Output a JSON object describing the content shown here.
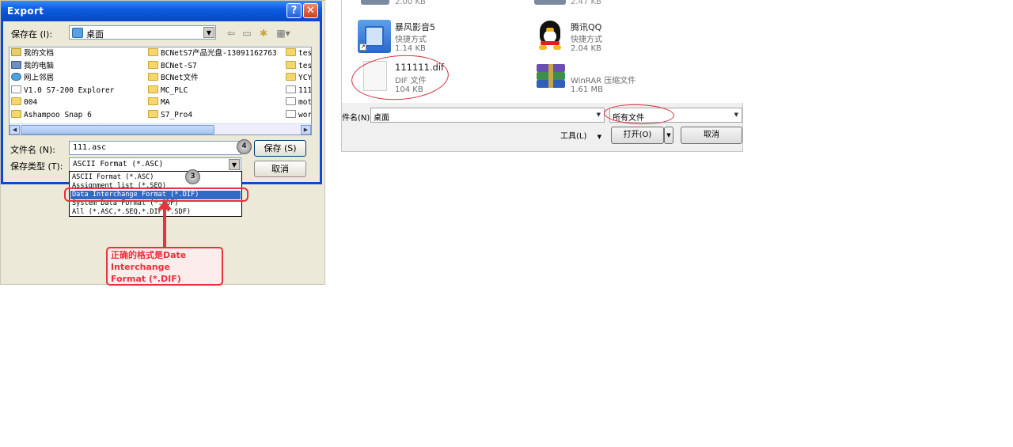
{
  "export_dialog": {
    "title": "Export",
    "help_glyph": "?",
    "close_glyph": "✕",
    "save_in_label": "保存在 (I):",
    "save_in_value": "桌面",
    "toolbar_icons": [
      "back-arrow-icon",
      "up-folder-icon",
      "new-folder-icon",
      "view-menu-icon"
    ],
    "files": [
      {
        "icon": "my-documents-icon",
        "name": "我的文档"
      },
      {
        "icon": "my-computer-icon",
        "name": "我的电脑"
      },
      {
        "icon": "network-places-icon",
        "name": "网上邻居"
      },
      {
        "icon": "application-icon",
        "name": "V1.0 S7-200 Explorer"
      },
      {
        "icon": "folder-icon",
        "name": "004"
      },
      {
        "icon": "folder-icon",
        "name": "Ashampoo Snap 6"
      },
      {
        "icon": "folder-icon",
        "name": "BCNetS7产品光盘-13091162763"
      },
      {
        "icon": "folder-icon",
        "name": "BCNet-S7"
      },
      {
        "icon": "folder-icon",
        "name": "BCNet文件"
      },
      {
        "icon": "folder-icon",
        "name": "MC_PLC"
      },
      {
        "icon": "folder-icon",
        "name": "MA"
      },
      {
        "icon": "folder-icon",
        "name": "S7_Pro4"
      },
      {
        "icon": "folder-icon",
        "name": "tes"
      },
      {
        "icon": "folder-icon",
        "name": "tes"
      },
      {
        "icon": "folder-icon",
        "name": "YCY"
      },
      {
        "icon": "file-icon",
        "name": "111"
      },
      {
        "icon": "file-icon",
        "name": "mot"
      },
      {
        "icon": "file-icon",
        "name": "wor"
      }
    ],
    "filename_label": "文件名 (N):",
    "filename_value": "111.asc",
    "save_button": "保存 (S)",
    "filetype_label": "保存类型 (T):",
    "filetype_value": "ASCII Format (*.ASC)",
    "cancel_button": "取消",
    "type_options": [
      "ASCII Format (*.ASC)",
      "Assignment list (*.SEQ)",
      "Data Interchange Format (*.DIF)",
      "System Data Format (*.SDF)",
      "All (*.ASC,*.SEQ,*.DIF,*.SDF)"
    ],
    "selected_option_index": 2,
    "badge_save": "4",
    "badge_type": "3",
    "note_text": [
      "正确的格式是Date",
      "Interchange",
      "Format (*.DIF)"
    ]
  },
  "open_dialog": {
    "top_cut_left": "2.00 KB",
    "top_cut_right": "2.47 KB",
    "files": [
      {
        "icon": "video-player-icon",
        "name": "暴风影音5",
        "type": "快捷方式",
        "size": "1.14 KB"
      },
      {
        "icon": "qq-penguin-icon",
        "name": "腾讯QQ",
        "type": "快捷方式",
        "size": "2.04 KB"
      },
      {
        "icon": "blank-file-icon",
        "name": "111111.dif",
        "type": "DIF 文件",
        "size": "104 KB"
      },
      {
        "icon": "winrar-archive-icon",
        "name": "",
        "type": "WinRAR 压缩文件",
        "size": "1.61 MB"
      }
    ],
    "filename_label": "件名(N):",
    "filename_value": "桌面",
    "filter_value": "所有文件",
    "tools_label": "工具(L)",
    "open_button": "打开(O)",
    "cancel_button": "取消"
  }
}
